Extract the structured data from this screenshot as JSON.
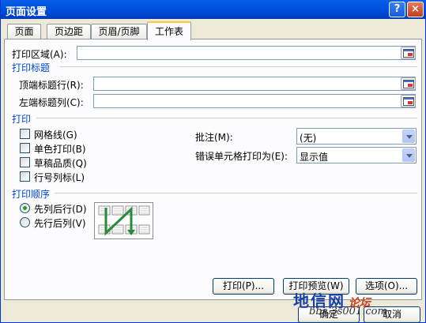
{
  "window": {
    "title": "页面设置",
    "help": "?",
    "close": "×"
  },
  "tabs": [
    {
      "label": "页面",
      "active": false
    },
    {
      "label": "页边距",
      "active": false
    },
    {
      "label": "页眉/页脚",
      "active": false
    },
    {
      "label": "工作表",
      "active": true
    }
  ],
  "sheet": {
    "print_area_label": "打印区域(A):",
    "print_area_value": "",
    "print_titles_heading": "打印标题",
    "top_rows_label": "顶端标题行(R):",
    "top_rows_value": "",
    "left_cols_label": "左端标题列(C):",
    "left_cols_value": "",
    "print_heading": "打印",
    "options": [
      {
        "label": "网格线(G)",
        "checked": false
      },
      {
        "label": "单色打印(B)",
        "checked": false
      },
      {
        "label": "草稿品质(Q)",
        "checked": false
      },
      {
        "label": "行号列标(L)",
        "checked": false
      }
    ],
    "comments_label": "批注(M):",
    "comments_value": "(无)",
    "errors_label": "错误单元格打印为(E):",
    "errors_value": "显示值",
    "order_heading": "打印顺序",
    "order_options": [
      {
        "label": "先列后行(D)",
        "selected": true
      },
      {
        "label": "先行后列(V)",
        "selected": false
      }
    ]
  },
  "buttons": {
    "print": "打印(P)...",
    "preview": "打印预览(W)",
    "options": "选项(O)...",
    "ok": "确定",
    "cancel": "取消"
  },
  "watermark": {
    "main": "地信网",
    "sub": "论坛",
    "url": "bbs.3s001.com"
  },
  "colors": {
    "title_bar": "#0053e1",
    "section_heading": "#0046d5",
    "dialog_bg": "#ece9d8"
  }
}
